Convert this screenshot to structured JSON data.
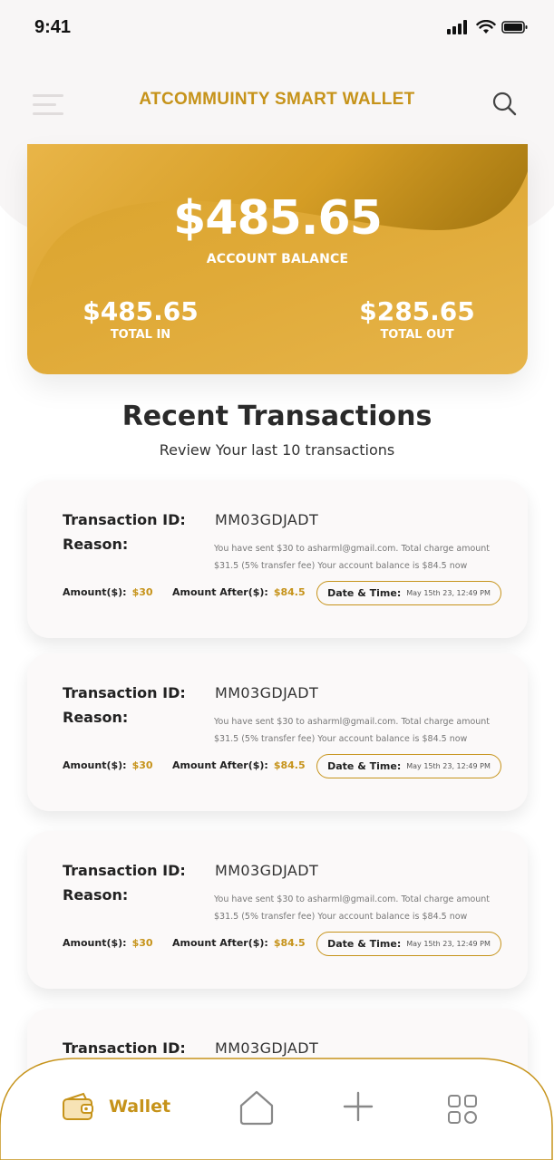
{
  "status": {
    "time": "9:41"
  },
  "header": {
    "title": "ATCOMMUINTY SMART WALLET"
  },
  "balance": {
    "amount": "$485.65",
    "label": "ACCOUNT BALANCE",
    "total_in": "$485.65",
    "total_in_label": "TOTAL IN",
    "total_out": "$285.65",
    "total_out_label": "TOTAL OUT"
  },
  "section": {
    "title": "Recent Transactions",
    "subtitle": "Review Your last 10 transactions"
  },
  "labels": {
    "transaction_id": "Transaction ID:",
    "reason": "Reason:",
    "amount": "Amount($):",
    "amount_after": "Amount After($):",
    "date_time": "Date & Time:"
  },
  "transactions": [
    {
      "id": "MM03GDJADT",
      "reason_line1": "You have sent $30 to asharml@gmail.com. Total charge amount",
      "reason_line2": "$31.5 (5% transfer fee) Your account balance is $84.5 now",
      "amount": "$30",
      "amount_after": "$84.5",
      "datetime": "May 15th 23, 12:49 PM"
    },
    {
      "id": "MM03GDJADT",
      "reason_line1": "You have sent $30 to asharml@gmail.com. Total charge amount",
      "reason_line2": "$31.5 (5% transfer fee) Your account balance is $84.5 now",
      "amount": "$30",
      "amount_after": "$84.5",
      "datetime": "May 15th 23, 12:49 PM"
    },
    {
      "id": "MM03GDJADT",
      "reason_line1": "You have sent $30 to asharml@gmail.com. Total charge amount",
      "reason_line2": "$31.5 (5% transfer fee) Your account balance is $84.5 now",
      "amount": "$30",
      "amount_after": "$84.5",
      "datetime": "May 15th 23, 12:49 PM"
    },
    {
      "id": "MM03GDJADT"
    }
  ],
  "nav": {
    "wallet_label": "Wallet"
  },
  "colors": {
    "accent": "#c6931a",
    "card": "#e0aa38"
  },
  "icons": [
    "menu-icon",
    "search-icon",
    "wallet-icon",
    "home-icon",
    "plus-icon",
    "grid-icon"
  ]
}
